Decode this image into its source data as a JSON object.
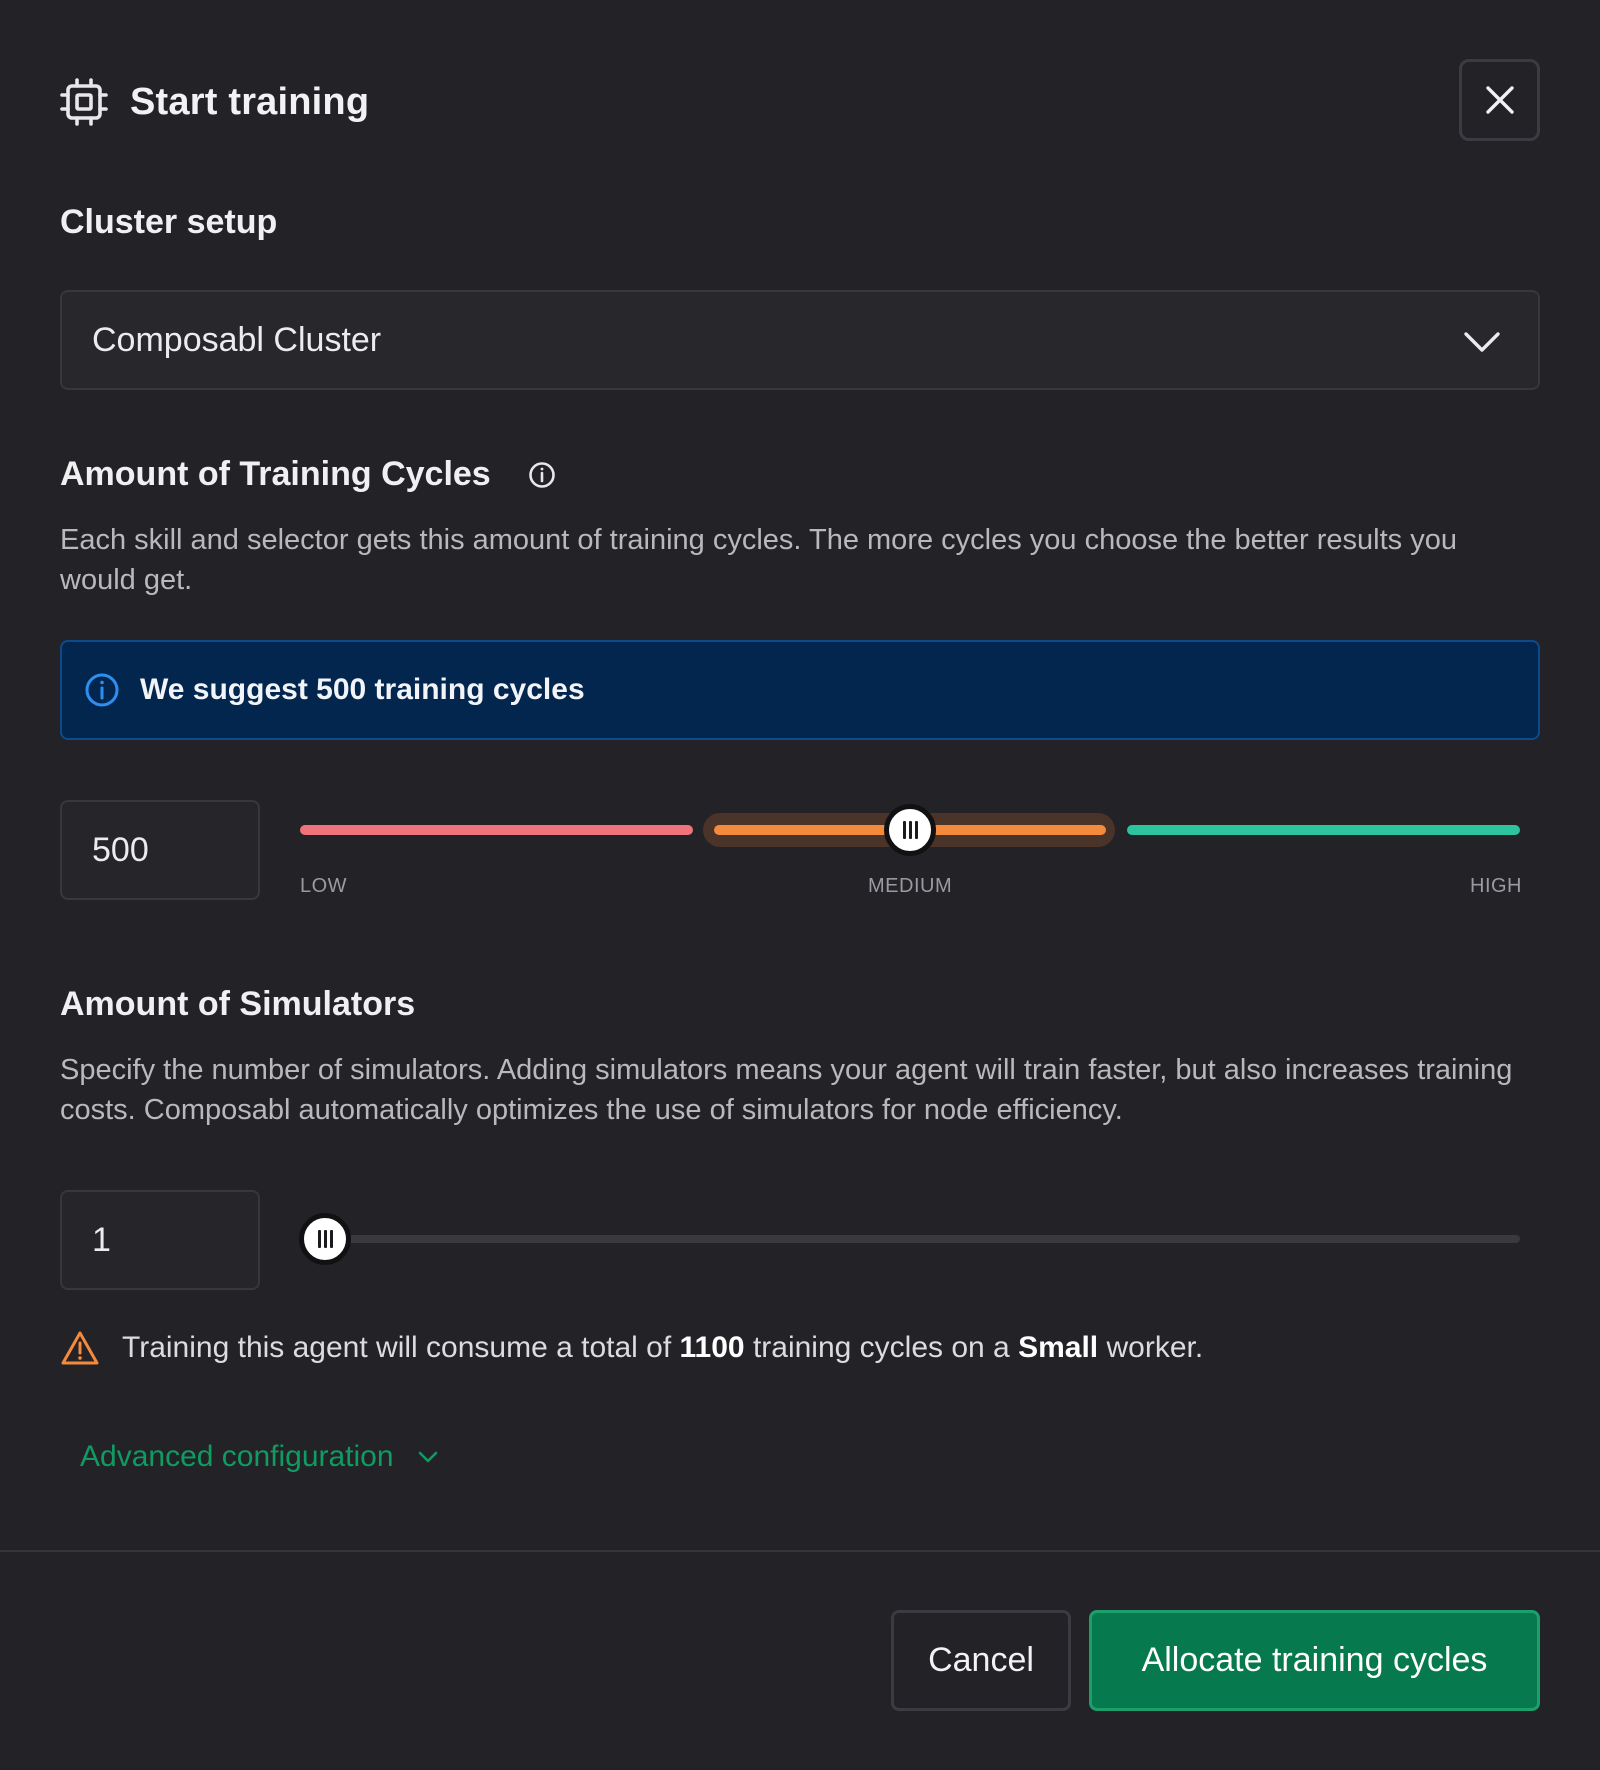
{
  "header": {
    "title": "Start training",
    "icon": "cpu-chip-icon",
    "close_icon": "close-icon"
  },
  "cluster": {
    "heading": "Cluster setup",
    "selected": "Composabl Cluster"
  },
  "cycles": {
    "heading": "Amount of Training Cycles",
    "description": "Each skill and selector gets this amount of training cycles. The more cycles you choose the better results you would get.",
    "suggestion": "We suggest 500 training cycles",
    "value": "500",
    "slider_level": "medium",
    "labels": {
      "low": "LOW",
      "medium": "MEDIUM",
      "high": "HIGH"
    },
    "colors": {
      "low": "#f0737b",
      "medium": "#f58a3d",
      "high": "#2dc39e"
    }
  },
  "simulators": {
    "heading": "Amount of Simulators",
    "description": "Specify the number of simulators. Adding simulators means your agent will train faster, but also increases training costs. Composabl automatically optimizes the use of simulators for node efficiency.",
    "value": "1",
    "slider_fraction": 0
  },
  "warning": {
    "prefix": "Training this agent will consume a total of ",
    "total": "1100",
    "middle": " training cycles on a ",
    "worker": "Small",
    "suffix": " worker."
  },
  "advanced": {
    "label": "Advanced configuration"
  },
  "footer": {
    "cancel": "Cancel",
    "primary": "Allocate training cycles"
  },
  "theme": {
    "accent": "#067a4e",
    "banner_bg": "#03264f",
    "warning": "#f58a3d",
    "background": "#232226"
  }
}
